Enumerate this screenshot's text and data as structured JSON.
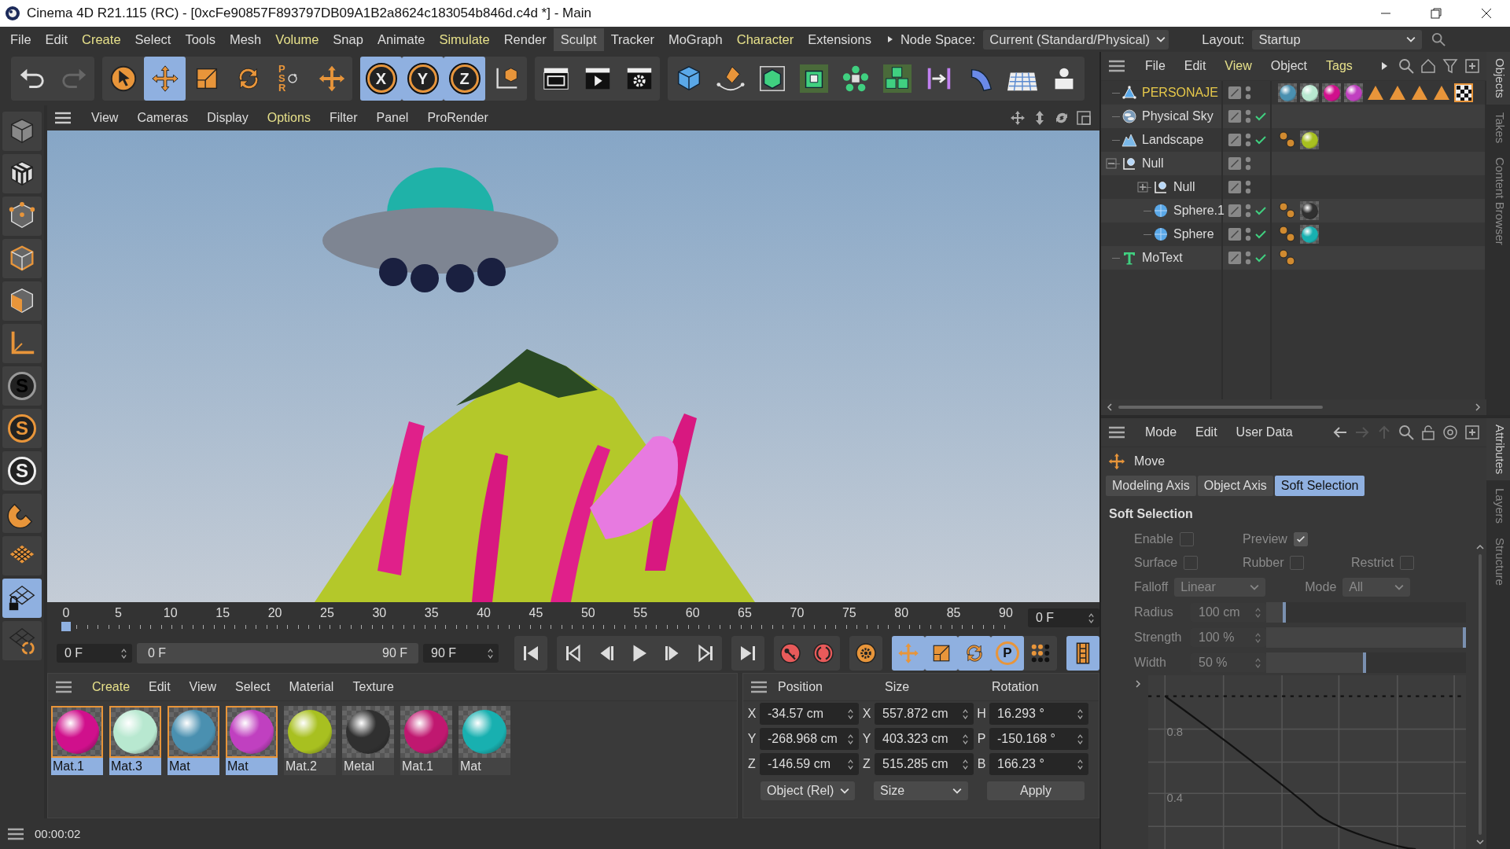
{
  "window": {
    "title": "Cinema 4D R21.115 (RC) - [0xcFe90857F893797DB09A1B2a8624c183054b846d.c4d *] - Main"
  },
  "menu_bar": [
    {
      "label": "File",
      "accent": false,
      "selected": false
    },
    {
      "label": "Edit",
      "accent": false,
      "selected": false
    },
    {
      "label": "Create",
      "accent": true,
      "selected": false
    },
    {
      "label": "Select",
      "accent": false,
      "selected": false
    },
    {
      "label": "Tools",
      "accent": false,
      "selected": false
    },
    {
      "label": "Mesh",
      "accent": false,
      "selected": false
    },
    {
      "label": "Volume",
      "accent": true,
      "selected": false
    },
    {
      "label": "Snap",
      "accent": false,
      "selected": false
    },
    {
      "label": "Animate",
      "accent": false,
      "selected": false
    },
    {
      "label": "Simulate",
      "accent": true,
      "selected": false
    },
    {
      "label": "Render",
      "accent": false,
      "selected": false
    },
    {
      "label": "Sculpt",
      "accent": false,
      "selected": true
    },
    {
      "label": "Tracker",
      "accent": false,
      "selected": false
    },
    {
      "label": "MoGraph",
      "accent": false,
      "selected": false
    },
    {
      "label": "Character",
      "accent": true,
      "selected": false
    },
    {
      "label": "Extensions",
      "accent": false,
      "selected": false
    }
  ],
  "node_space": {
    "label": "Node Space:",
    "value": "Current (Standard/Physical)"
  },
  "layout": {
    "label": "Layout:",
    "value": "Startup"
  },
  "toolbar": [
    [
      {
        "kind": "undo",
        "active": false
      },
      {
        "kind": "redo",
        "active": false
      }
    ],
    [
      {
        "kind": "select",
        "active": false
      },
      {
        "kind": "move",
        "active": true
      },
      {
        "kind": "scale",
        "active": false
      },
      {
        "kind": "rotate",
        "active": false
      },
      {
        "kind": "psr",
        "label": "PSR",
        "active": false
      },
      {
        "kind": "axis-move",
        "active": false
      }
    ],
    [
      {
        "kind": "axis-lock",
        "label": "X",
        "active": true
      },
      {
        "kind": "axis-lock",
        "label": "Y",
        "active": true
      },
      {
        "kind": "axis-lock",
        "label": "Z",
        "active": true
      },
      {
        "kind": "coord-system",
        "active": false
      }
    ],
    [
      {
        "kind": "render-view",
        "active": false
      },
      {
        "kind": "render",
        "active": false
      },
      {
        "kind": "render-settings",
        "active": false
      }
    ],
    [
      {
        "kind": "cube",
        "active": false
      },
      {
        "kind": "pen",
        "active": false
      },
      {
        "kind": "subdivision",
        "active": false
      },
      {
        "kind": "extrude",
        "active": false
      },
      {
        "kind": "cloner",
        "active": false
      },
      {
        "kind": "array",
        "active": false
      },
      {
        "kind": "symmetry",
        "active": false
      },
      {
        "kind": "deformer",
        "active": false
      },
      {
        "kind": "floor",
        "active": false
      },
      {
        "kind": "camera",
        "active": false
      }
    ]
  ],
  "left_toolbar": [
    {
      "kind": "model",
      "active": false
    },
    {
      "kind": "texture",
      "active": false
    },
    {
      "kind": "points",
      "active": false
    },
    {
      "kind": "edges",
      "active": false
    },
    {
      "kind": "polygons",
      "active": false
    },
    {
      "kind": "axis",
      "active": false
    },
    {
      "kind": "snap",
      "label": "S",
      "active": false
    },
    {
      "kind": "snap-quantize",
      "label": "S",
      "active": false
    },
    {
      "kind": "snap-plane",
      "label": "S",
      "active": false
    },
    {
      "kind": "magnet",
      "active": false
    },
    {
      "kind": "workplane",
      "active": false
    },
    {
      "kind": "workplane-lock",
      "active": true
    },
    {
      "kind": "workplane-sync",
      "active": false
    }
  ],
  "viewport": {
    "menu": [
      {
        "label": "View",
        "accent": false
      },
      {
        "label": "Cameras",
        "accent": false
      },
      {
        "label": "Display",
        "accent": false
      },
      {
        "label": "Options",
        "accent": true
      },
      {
        "label": "Filter",
        "accent": false
      },
      {
        "label": "Panel",
        "accent": false
      },
      {
        "label": "ProRender",
        "accent": false
      }
    ]
  },
  "timeline": {
    "ticks": [
      "0",
      "5",
      "10",
      "15",
      "20",
      "25",
      "30",
      "35",
      "40",
      "45",
      "50",
      "55",
      "60",
      "65",
      "70",
      "75",
      "80",
      "85",
      "90"
    ],
    "playhead": {
      "level": 0
    },
    "current_frame": "0 F"
  },
  "transport": {
    "start": "0 F",
    "range_start": "0 F",
    "range_end": "90 F",
    "end": "90 F",
    "buttons": [
      [
        {
          "kind": "first-frame",
          "active": false
        }
      ],
      [
        {
          "kind": "prev-key",
          "active": false
        },
        {
          "kind": "prev-frame",
          "active": false
        },
        {
          "kind": "play",
          "active": false
        },
        {
          "kind": "next-frame",
          "active": false
        },
        {
          "kind": "next-key",
          "active": false
        }
      ],
      [
        {
          "kind": "last-frame",
          "active": false
        }
      ],
      [
        {
          "kind": "record",
          "active": false
        },
        {
          "kind": "autokey",
          "active": false
        }
      ],
      [
        {
          "kind": "keyset",
          "active": false
        }
      ],
      [
        {
          "kind": "key-move",
          "active": true
        },
        {
          "kind": "key-scale",
          "active": true
        },
        {
          "kind": "key-rotate",
          "active": true
        },
        {
          "kind": "key-param",
          "label": "P",
          "active": true
        },
        {
          "kind": "key-pla",
          "active": false
        }
      ],
      [
        {
          "kind": "timeline-window",
          "active": true
        }
      ]
    ]
  },
  "materials": {
    "menu": [
      {
        "label": "Create",
        "accent": true
      },
      {
        "label": "Edit",
        "accent": false
      },
      {
        "label": "View",
        "accent": false
      },
      {
        "label": "Select",
        "accent": false
      },
      {
        "label": "Material",
        "accent": false
      },
      {
        "label": "Texture",
        "accent": false
      }
    ],
    "items": [
      {
        "name": "Mat.1",
        "color": "#d0108c",
        "selected": true
      },
      {
        "name": "Mat.3",
        "color": "#b8e8d0",
        "selected": true
      },
      {
        "name": "Mat",
        "color": "#4a90b0",
        "selected": true
      },
      {
        "name": "Mat",
        "color": "#c040c0",
        "selected": true
      },
      {
        "name": "Mat.2",
        "color": "#a8c020",
        "selected": false
      },
      {
        "name": "Metal",
        "color": "#303030",
        "selected": false
      },
      {
        "name": "Mat.1",
        "color": "#c01870",
        "selected": false
      },
      {
        "name": "Mat",
        "color": "#18b0b0",
        "selected": false
      }
    ]
  },
  "coordinates": {
    "headers": [
      "Position",
      "Size",
      "Rotation"
    ],
    "rows": [
      [
        {
          "axis": "X",
          "value": "-34.57 cm"
        },
        {
          "axis": "X",
          "value": "557.872 cm"
        },
        {
          "axis": "H",
          "value": "16.293 °"
        }
      ],
      [
        {
          "axis": "Y",
          "value": "-268.968 cm"
        },
        {
          "axis": "Y",
          "value": "403.323 cm"
        },
        {
          "axis": "P",
          "value": "-150.168 °"
        }
      ],
      [
        {
          "axis": "Z",
          "value": "-146.59 cm"
        },
        {
          "axis": "Z",
          "value": "515.285 cm"
        },
        {
          "axis": "B",
          "value": "166.23 °"
        }
      ]
    ],
    "mode": "Object (Rel)",
    "size_mode": "Size",
    "apply": "Apply"
  },
  "status_bar": {
    "time": "00:00:02"
  },
  "objects": {
    "menu": [
      {
        "label": "File",
        "accent": false
      },
      {
        "label": "Edit",
        "accent": false
      },
      {
        "label": "View",
        "accent": true
      },
      {
        "label": "Object",
        "accent": false
      },
      {
        "label": "Tags",
        "accent": true
      }
    ],
    "items": [
      {
        "name": "PERSONAJE",
        "kind": "polygon-group",
        "selected": true,
        "check": false,
        "tags": [
          {
            "kind": "material",
            "color": "#4a90b0"
          },
          {
            "kind": "material",
            "color": "#b8e8d0"
          },
          {
            "kind": "material",
            "color": "#d0108c"
          },
          {
            "kind": "material",
            "color": "#c040c0"
          },
          {
            "kind": "selection"
          },
          {
            "kind": "selection"
          },
          {
            "kind": "selection"
          },
          {
            "kind": "selection"
          },
          {
            "kind": "texture"
          }
        ]
      },
      {
        "name": "Physical Sky",
        "kind": "sky",
        "selected": false,
        "check": true
      },
      {
        "name": "Landscape",
        "kind": "landscape",
        "selected": false,
        "check": true,
        "tags": [
          {
            "kind": "phong"
          },
          {
            "kind": "material",
            "color": "#a8c020"
          }
        ]
      },
      {
        "name": "Null",
        "kind": "null",
        "selected": false,
        "check": false,
        "expanded": true,
        "children": [
          {
            "name": "Null",
            "kind": "null",
            "selected": false,
            "check": false,
            "expanded": false
          },
          {
            "name": "Sphere.1",
            "kind": "sphere",
            "selected": false,
            "check": true,
            "tags": [
              {
                "kind": "phong"
              },
              {
                "kind": "material",
                "color": "#303030"
              }
            ]
          },
          {
            "name": "Sphere",
            "kind": "sphere",
            "selected": false,
            "check": true,
            "tags": [
              {
                "kind": "phong"
              },
              {
                "kind": "material",
                "color": "#18b0b0"
              }
            ]
          }
        ]
      },
      {
        "name": "MoText",
        "kind": "motext",
        "selected": false,
        "check": true,
        "tags": [
          {
            "kind": "phong"
          }
        ]
      }
    ]
  },
  "side_tabs_top": [
    {
      "label": "Objects",
      "selected": true
    },
    {
      "label": "Takes",
      "selected": false
    },
    {
      "label": "Content Browser",
      "selected": false
    }
  ],
  "attributes": {
    "menu": [
      "Mode",
      "Edit",
      "User Data"
    ],
    "tool": "Move",
    "tabs": [
      {
        "label": "Modeling Axis",
        "selected": false
      },
      {
        "label": "Object Axis",
        "selected": false
      },
      {
        "label": "Soft Selection",
        "selected": true
      }
    ],
    "section": "Soft Selection",
    "checkbox_rows": [
      [
        {
          "label": "Enable",
          "checked": false
        },
        {
          "label": "Preview",
          "checked": true
        }
      ],
      [
        {
          "label": "Surface",
          "checked": false
        },
        {
          "label": "Rubber",
          "checked": false
        },
        {
          "label": "Restrict",
          "checked": false
        }
      ]
    ],
    "dropdowns": [
      {
        "label": "Falloff",
        "value": "Linear"
      },
      {
        "label": "Mode",
        "value": "All"
      }
    ],
    "sliders": [
      {
        "label": "Radius",
        "value": "100 cm",
        "level": 0.1
      },
      {
        "label": "Strength",
        "value": "100 %",
        "level": 1
      },
      {
        "label": "Width",
        "value": "50 %",
        "level": 0.5
      }
    ],
    "graph_labels": [
      "0.8",
      "0.4"
    ]
  },
  "side_tabs_bottom": [
    {
      "label": "Attributes",
      "selected": true
    },
    {
      "label": "Layers",
      "selected": false
    },
    {
      "label": "Structure",
      "selected": false
    }
  ]
}
